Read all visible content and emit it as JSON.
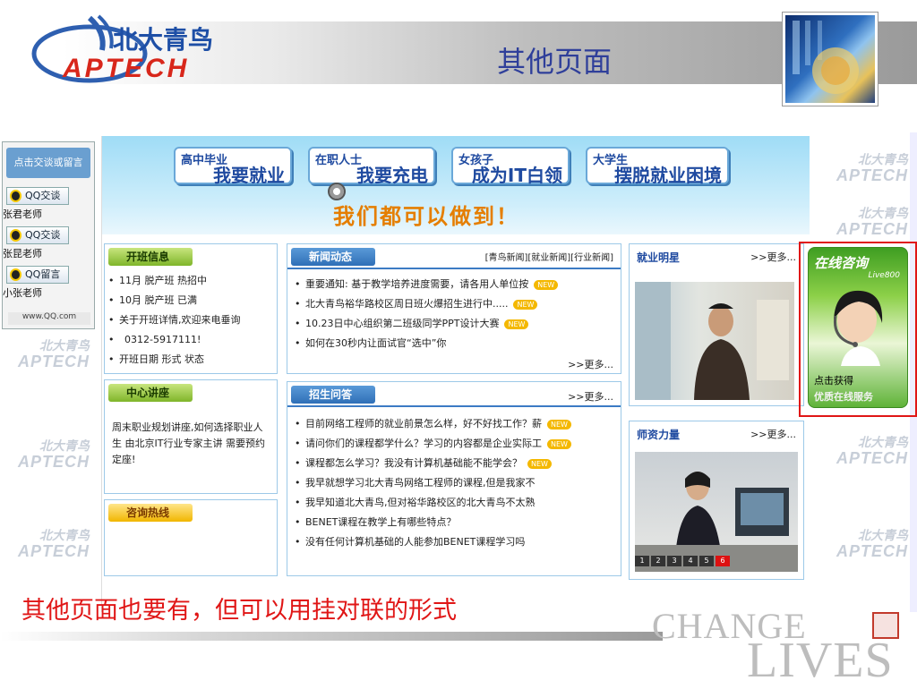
{
  "slide": {
    "title": "其他页面",
    "caption": "其他页面也要有，但可以用挂对联的形式",
    "logo_cn": "北大青鸟",
    "logo_en": "APTECH",
    "deco_words": [
      "CHANGE",
      "LIVES"
    ]
  },
  "qq_panel": {
    "top_label": "点击交谈或留言",
    "buttons": [
      "QQ交谈",
      "QQ交谈",
      "QQ留言"
    ],
    "names": [
      "张君老师",
      "张昆老师",
      "小张老师"
    ],
    "footer": "www.QQ.com"
  },
  "banner": {
    "clouds": [
      {
        "small": "高中毕业",
        "big": "我要就业"
      },
      {
        "small": "在职人士",
        "big": "我要充电"
      },
      {
        "small": "女孩子",
        "big": "成为IT白领"
      },
      {
        "small": "大学生",
        "big": "摆脱就业困境"
      }
    ],
    "slogan": "我们都可以做到！"
  },
  "class_info": {
    "title": "开班信息",
    "items": [
      "11月 脱产班 热招中",
      "10月 脱产班 已满",
      "关于开班详情,欢迎来电垂询",
      "0312-5917111!",
      "开班日期 形式 状态"
    ]
  },
  "lecture": {
    "title": "中心讲座",
    "text": "周末职业规划讲座,如何选择职业人生 由北京IT行业专家主讲 需要预约定座!"
  },
  "hotline": {
    "title": "咨询热线"
  },
  "news": {
    "title": "新闻动态",
    "links": "[青鸟新闻][就业新闻][行业新闻]",
    "items": [
      {
        "text": "重要通知: 基于教学培养进度需要，请各用人单位按",
        "new": true
      },
      {
        "text": "北大青鸟裕华路校区周日班火爆招生进行中.....",
        "new": true
      },
      {
        "text": "10.23日中心组织第二班级同学PPT设计大赛",
        "new": true
      },
      {
        "text": "如何在30秒内让面试官“选中”你",
        "new": false
      }
    ],
    "more": ">>更多..."
  },
  "faq": {
    "title": "招生问答",
    "more": ">>更多...",
    "items": [
      {
        "text": "目前网络工程师的就业前景怎么样，好不好找工作？薪",
        "new": true
      },
      {
        "text": "请问你们的课程都学什么？学习的内容都是企业实际工",
        "new": true
      },
      {
        "text": "课程都怎么学习？我没有计算机基础能不能学会？",
        "new": true
      },
      {
        "text": "我早就想学习北大青鸟网络工程师的课程,但是我家不",
        "new": false
      },
      {
        "text": "我早知道北大青鸟,但对裕华路校区的北大青鸟不太熟",
        "new": false
      },
      {
        "text": "BENET课程在教学上有哪些特点？",
        "new": false
      },
      {
        "text": "没有任何计算机基础的人能参加BENET课程学习吗",
        "new": false
      }
    ]
  },
  "star": {
    "title": "就业明星",
    "more": ">>更多..."
  },
  "teachers": {
    "title": "师资力量",
    "more": ">>更多...",
    "pages": [
      "1",
      "2",
      "3",
      "4",
      "5",
      "6"
    ],
    "active_page": "6"
  },
  "consult": {
    "heading": "在线咨询",
    "brand": "Live800",
    "line1": "点击获得",
    "line2": "优质在线服务"
  },
  "new_badge": "NEW",
  "watermark": {
    "cn": "北大青鸟",
    "en": "APTECH"
  }
}
